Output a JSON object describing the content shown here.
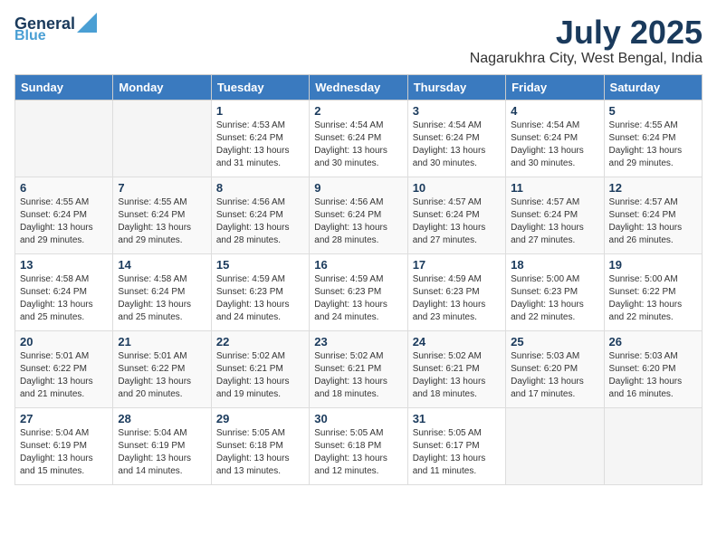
{
  "header": {
    "logo_text1": "General",
    "logo_text2": "Blue",
    "month_year": "July 2025",
    "city": "Nagarukhra City, West Bengal, India"
  },
  "weekdays": [
    "Sunday",
    "Monday",
    "Tuesday",
    "Wednesday",
    "Thursday",
    "Friday",
    "Saturday"
  ],
  "weeks": [
    [
      {
        "day": "",
        "info": ""
      },
      {
        "day": "",
        "info": ""
      },
      {
        "day": "1",
        "info": "Sunrise: 4:53 AM\nSunset: 6:24 PM\nDaylight: 13 hours and 31 minutes."
      },
      {
        "day": "2",
        "info": "Sunrise: 4:54 AM\nSunset: 6:24 PM\nDaylight: 13 hours and 30 minutes."
      },
      {
        "day": "3",
        "info": "Sunrise: 4:54 AM\nSunset: 6:24 PM\nDaylight: 13 hours and 30 minutes."
      },
      {
        "day": "4",
        "info": "Sunrise: 4:54 AM\nSunset: 6:24 PM\nDaylight: 13 hours and 30 minutes."
      },
      {
        "day": "5",
        "info": "Sunrise: 4:55 AM\nSunset: 6:24 PM\nDaylight: 13 hours and 29 minutes."
      }
    ],
    [
      {
        "day": "6",
        "info": "Sunrise: 4:55 AM\nSunset: 6:24 PM\nDaylight: 13 hours and 29 minutes."
      },
      {
        "day": "7",
        "info": "Sunrise: 4:55 AM\nSunset: 6:24 PM\nDaylight: 13 hours and 29 minutes."
      },
      {
        "day": "8",
        "info": "Sunrise: 4:56 AM\nSunset: 6:24 PM\nDaylight: 13 hours and 28 minutes."
      },
      {
        "day": "9",
        "info": "Sunrise: 4:56 AM\nSunset: 6:24 PM\nDaylight: 13 hours and 28 minutes."
      },
      {
        "day": "10",
        "info": "Sunrise: 4:57 AM\nSunset: 6:24 PM\nDaylight: 13 hours and 27 minutes."
      },
      {
        "day": "11",
        "info": "Sunrise: 4:57 AM\nSunset: 6:24 PM\nDaylight: 13 hours and 27 minutes."
      },
      {
        "day": "12",
        "info": "Sunrise: 4:57 AM\nSunset: 6:24 PM\nDaylight: 13 hours and 26 minutes."
      }
    ],
    [
      {
        "day": "13",
        "info": "Sunrise: 4:58 AM\nSunset: 6:24 PM\nDaylight: 13 hours and 25 minutes."
      },
      {
        "day": "14",
        "info": "Sunrise: 4:58 AM\nSunset: 6:24 PM\nDaylight: 13 hours and 25 minutes."
      },
      {
        "day": "15",
        "info": "Sunrise: 4:59 AM\nSunset: 6:23 PM\nDaylight: 13 hours and 24 minutes."
      },
      {
        "day": "16",
        "info": "Sunrise: 4:59 AM\nSunset: 6:23 PM\nDaylight: 13 hours and 24 minutes."
      },
      {
        "day": "17",
        "info": "Sunrise: 4:59 AM\nSunset: 6:23 PM\nDaylight: 13 hours and 23 minutes."
      },
      {
        "day": "18",
        "info": "Sunrise: 5:00 AM\nSunset: 6:23 PM\nDaylight: 13 hours and 22 minutes."
      },
      {
        "day": "19",
        "info": "Sunrise: 5:00 AM\nSunset: 6:22 PM\nDaylight: 13 hours and 22 minutes."
      }
    ],
    [
      {
        "day": "20",
        "info": "Sunrise: 5:01 AM\nSunset: 6:22 PM\nDaylight: 13 hours and 21 minutes."
      },
      {
        "day": "21",
        "info": "Sunrise: 5:01 AM\nSunset: 6:22 PM\nDaylight: 13 hours and 20 minutes."
      },
      {
        "day": "22",
        "info": "Sunrise: 5:02 AM\nSunset: 6:21 PM\nDaylight: 13 hours and 19 minutes."
      },
      {
        "day": "23",
        "info": "Sunrise: 5:02 AM\nSunset: 6:21 PM\nDaylight: 13 hours and 18 minutes."
      },
      {
        "day": "24",
        "info": "Sunrise: 5:02 AM\nSunset: 6:21 PM\nDaylight: 13 hours and 18 minutes."
      },
      {
        "day": "25",
        "info": "Sunrise: 5:03 AM\nSunset: 6:20 PM\nDaylight: 13 hours and 17 minutes."
      },
      {
        "day": "26",
        "info": "Sunrise: 5:03 AM\nSunset: 6:20 PM\nDaylight: 13 hours and 16 minutes."
      }
    ],
    [
      {
        "day": "27",
        "info": "Sunrise: 5:04 AM\nSunset: 6:19 PM\nDaylight: 13 hours and 15 minutes."
      },
      {
        "day": "28",
        "info": "Sunrise: 5:04 AM\nSunset: 6:19 PM\nDaylight: 13 hours and 14 minutes."
      },
      {
        "day": "29",
        "info": "Sunrise: 5:05 AM\nSunset: 6:18 PM\nDaylight: 13 hours and 13 minutes."
      },
      {
        "day": "30",
        "info": "Sunrise: 5:05 AM\nSunset: 6:18 PM\nDaylight: 13 hours and 12 minutes."
      },
      {
        "day": "31",
        "info": "Sunrise: 5:05 AM\nSunset: 6:17 PM\nDaylight: 13 hours and 11 minutes."
      },
      {
        "day": "",
        "info": ""
      },
      {
        "day": "",
        "info": ""
      }
    ]
  ]
}
